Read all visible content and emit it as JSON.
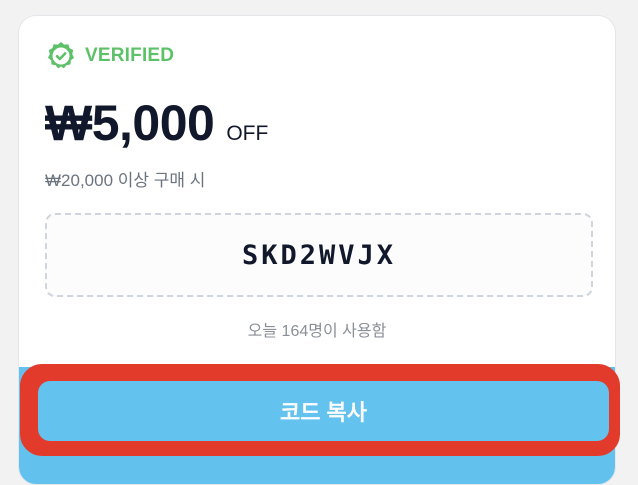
{
  "coupon": {
    "badge_label": "VERIFIED",
    "badge_icon": "verified-badge-icon",
    "amount": "₩5,000",
    "amount_suffix": "OFF",
    "condition": "₩20,000 이상 구매 시",
    "code": "SKD2WVJX",
    "usage_text": "오늘 164명이 사용함",
    "copy_button_label": "코드 복사"
  },
  "colors": {
    "verified_green": "#5cc169",
    "button_blue": "#64c2ee",
    "highlight_red": "#e33b2b",
    "text_dark": "#12182b"
  }
}
